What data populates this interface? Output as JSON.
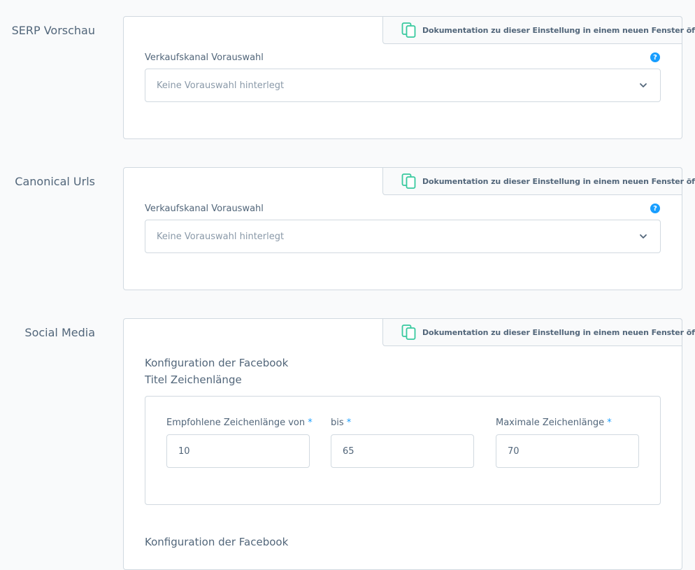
{
  "doc_link_label": "Dokumentation zu dieser Einstellung in einem neuen Fenster öffnen",
  "sections": [
    {
      "title": "SERP Vorschau",
      "field_label": "Verkaufskanal Vorauswahl",
      "help": "?",
      "select_placeholder": "Keine Vorauswahl hinterlegt"
    },
    {
      "title": "Canonical Urls",
      "field_label": "Verkaufskanal Vorauswahl",
      "help": "?",
      "select_placeholder": "Keine Vorauswahl hinterlegt"
    },
    {
      "title": "Social Media",
      "config_heading_line1": "Konfiguration der Facebook",
      "config_heading_line2": "Titel Zeichenlänge",
      "fields": [
        {
          "label": "Empfohlene Zeichenlänge von",
          "required": "*",
          "value": "10"
        },
        {
          "label": "bis",
          "required": "*",
          "value": "65"
        },
        {
          "label": "Maximale Zeichenlänge",
          "required": "*",
          "value": "70"
        }
      ],
      "config_heading_next": "Konfiguration der Facebook"
    }
  ],
  "colors": {
    "accent": "#189eff",
    "doc_icon": "#37c99e",
    "text": "#52667a",
    "border": "#d1d9e0"
  },
  "icons": {
    "doc": "document-copy-icon",
    "help": "question-mark-icon",
    "chevron": "chevron-down-icon"
  }
}
